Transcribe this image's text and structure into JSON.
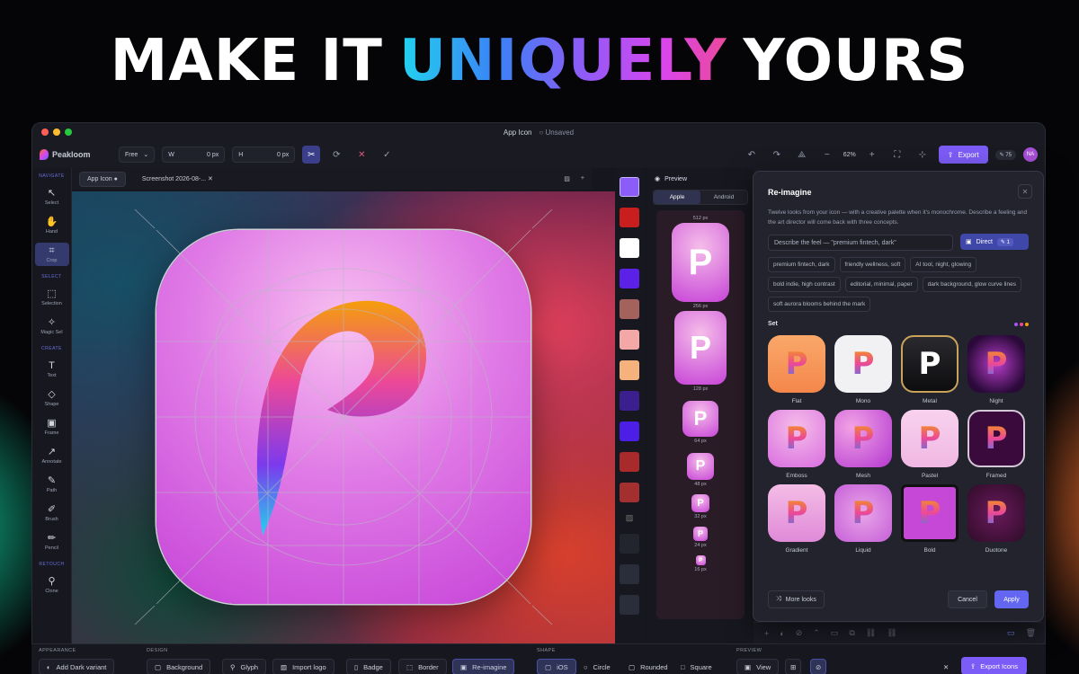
{
  "hero": {
    "part1": "MAKE IT",
    "highlight": "UNIQUELY",
    "part2": "YOURS"
  },
  "window": {
    "title": "App Icon",
    "status": "Unsaved"
  },
  "toolbar": {
    "app_name": "Peakloom",
    "mode": "Free",
    "w_label": "W",
    "w_value": "0 px",
    "h_label": "H",
    "h_value": "0 px",
    "zoom": "62%",
    "export_label": "Export",
    "credits": "75",
    "avatar": "NA"
  },
  "leftbar": {
    "sections": [
      "NAVIGATE",
      "SELECT",
      "CREATE",
      "RETOUCH"
    ],
    "tools": [
      {
        "label": "Select",
        "icon": "↖"
      },
      {
        "label": "Hand",
        "icon": "✋"
      },
      {
        "label": "Crop",
        "icon": "⌗"
      },
      {
        "label": "Selection",
        "icon": "⬚"
      },
      {
        "label": "Magic Sel",
        "icon": "✧"
      },
      {
        "label": "Text",
        "icon": "T"
      },
      {
        "label": "Shape",
        "icon": "◇"
      },
      {
        "label": "Frame",
        "icon": "▣"
      },
      {
        "label": "Annotate",
        "icon": "↗"
      },
      {
        "label": "Path",
        "icon": "✎"
      },
      {
        "label": "Brush",
        "icon": "✐"
      },
      {
        "label": "Pencil",
        "icon": "✏"
      },
      {
        "label": "Clone",
        "icon": "⚲"
      }
    ]
  },
  "tabs": [
    {
      "label": "App Icon"
    },
    {
      "label": "Screenshot 2026-08-..."
    }
  ],
  "swatches": [
    "#8b5cf6",
    "#c81e1e",
    "#ffffff",
    "#5b21e6",
    "#a4625c",
    "#f3a7a7",
    "#f6b27c",
    "#3b1f8f",
    "#4c1ee6",
    "#a82a2a",
    "#a32f2f"
  ],
  "preview": {
    "title": "Preview",
    "seg_apple": "Apple",
    "seg_android": "Android",
    "sizes": [
      "512 px",
      "256 px",
      "128 px",
      "64 px",
      "48 px",
      "32 px",
      "24 px",
      "16 px"
    ]
  },
  "reimagine": {
    "title": "Re-imagine",
    "description": "Twelve looks from your icon — with a creative palette when it's monochrome. Describe a feeling and the art director will come back with three concepts.",
    "feel_placeholder": "Describe the feel — \"premium fintech, dark\"",
    "direct_label": "Direct",
    "direct_count": "1",
    "chips": [
      "premium fintech, dark",
      "friendly wellness, soft",
      "AI tool, night, glowing",
      "bold indie, high contrast",
      "editorial, minimal, paper",
      "dark background, glow curve lines",
      "soft aurora blooms behind the mark"
    ],
    "set_label": "Set",
    "looks": [
      "Flat",
      "Mono",
      "Metal",
      "Night",
      "Emboss",
      "Mesh",
      "Pastel",
      "Framed",
      "Gradient",
      "Liquid",
      "Bold",
      "Duotone"
    ],
    "more_looks": "More looks",
    "cancel": "Cancel",
    "apply": "Apply"
  },
  "bottom": {
    "appearance": "APPEARANCE",
    "design": "DESIGN",
    "shape": "SHAPE",
    "preview": "PREVIEW",
    "add_dark": "Add Dark variant",
    "background": "Background",
    "glyph": "Glyph",
    "import_logo": "Import logo",
    "badge": "Badge",
    "border": "Border",
    "reimagine": "Re-imagine",
    "ios": "iOS",
    "circle": "Circle",
    "rounded": "Rounded",
    "square": "Square",
    "view": "View",
    "export_icons": "Export Icons"
  }
}
